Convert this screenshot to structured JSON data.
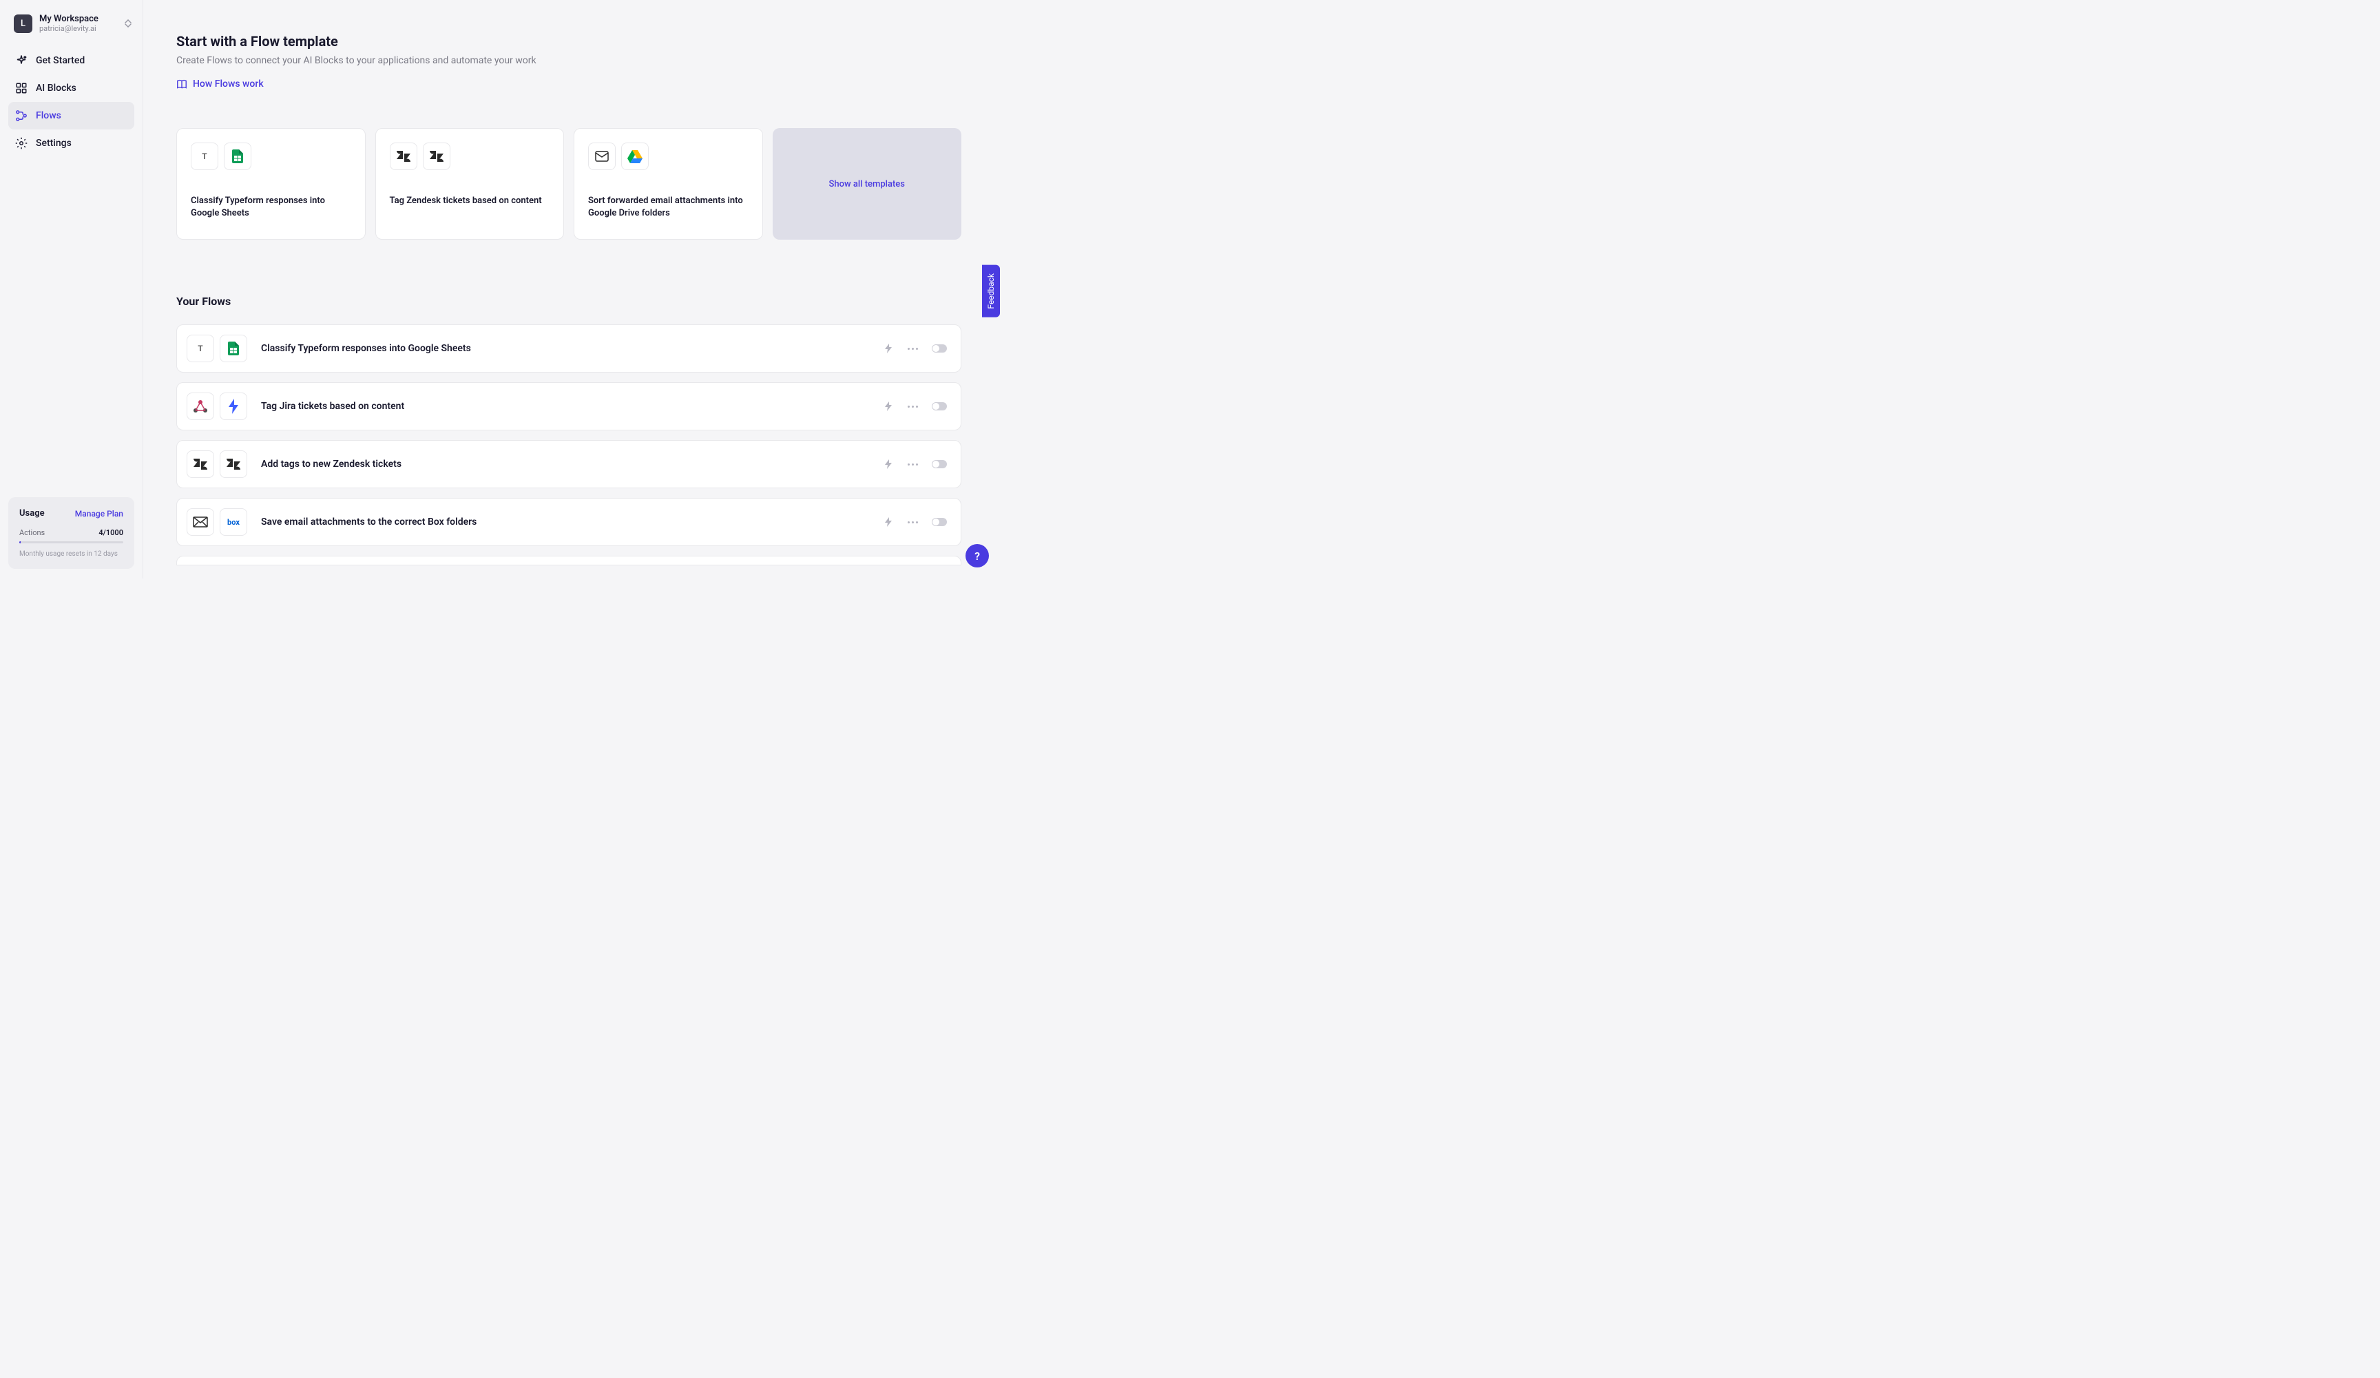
{
  "workspace": {
    "avatar_letter": "L",
    "name": "My Workspace",
    "email": "patricia@levity.ai"
  },
  "nav": {
    "get_started": "Get Started",
    "ai_blocks": "AI Blocks",
    "flows": "Flows",
    "settings": "Settings"
  },
  "usage": {
    "title": "Usage",
    "manage": "Manage Plan",
    "actions_label": "Actions",
    "actions_value": "4/1000",
    "note": "Monthly usage resets in 12 days"
  },
  "header": {
    "title": "Start with a Flow template",
    "subtitle": "Create Flows to connect your AI Blocks to your applications and automate your work",
    "how_link": "How Flows work"
  },
  "templates": [
    {
      "title": "Classify Typeform responses into Google Sheets",
      "icons": [
        "typeform",
        "gsheets"
      ]
    },
    {
      "title": "Tag Zendesk tickets based on content",
      "icons": [
        "zendesk",
        "zendesk"
      ]
    },
    {
      "title": "Sort forwarded email attachments into Google Drive folders",
      "icons": [
        "email",
        "gdrive"
      ]
    }
  ],
  "show_all": "Show all templates",
  "your_flows_title": "Your Flows",
  "flows": [
    {
      "title": "Classify Typeform responses into Google Sheets",
      "icons": [
        "typeform",
        "gsheets"
      ]
    },
    {
      "title": "Tag Jira tickets based on content",
      "icons": [
        "jira-webhook",
        "bolt-blue"
      ]
    },
    {
      "title": "Add tags to new Zendesk tickets",
      "icons": [
        "zendesk",
        "zendesk"
      ]
    },
    {
      "title": "Save email attachments to the correct Box folders",
      "icons": [
        "email-outline",
        "box"
      ]
    }
  ],
  "feedback": "Feedback",
  "help": "?"
}
